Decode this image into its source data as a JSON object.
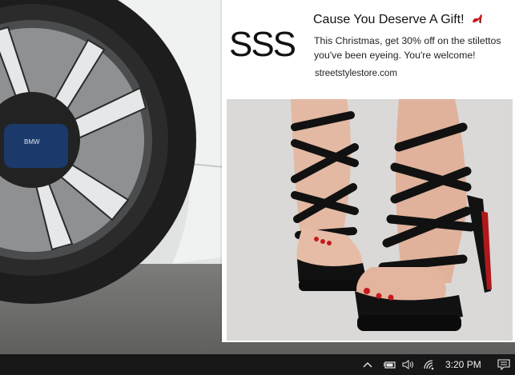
{
  "notification": {
    "logo_text": "SSS",
    "title": "Cause You Deserve A Gift!",
    "title_icon": "high-heel-icon",
    "body": "This Christmas, get 30% off on the stilettos you've been eyeing. You're welcome!",
    "site": "streetstylestore.com",
    "hero_image": "black-strappy-stiletto-sandals-photo"
  },
  "wallpaper": {
    "subject": "car-wheel-photo",
    "badge_text": "BMW"
  },
  "taskbar": {
    "clock": "3:20 PM",
    "tray_icons": [
      "chevron-up-icon",
      "battery-icon",
      "volume-icon",
      "wifi-icon",
      "action-center-icon"
    ]
  },
  "colors": {
    "taskbar": "#171717",
    "card": "#ffffff",
    "accent_red": "#d0141c"
  }
}
